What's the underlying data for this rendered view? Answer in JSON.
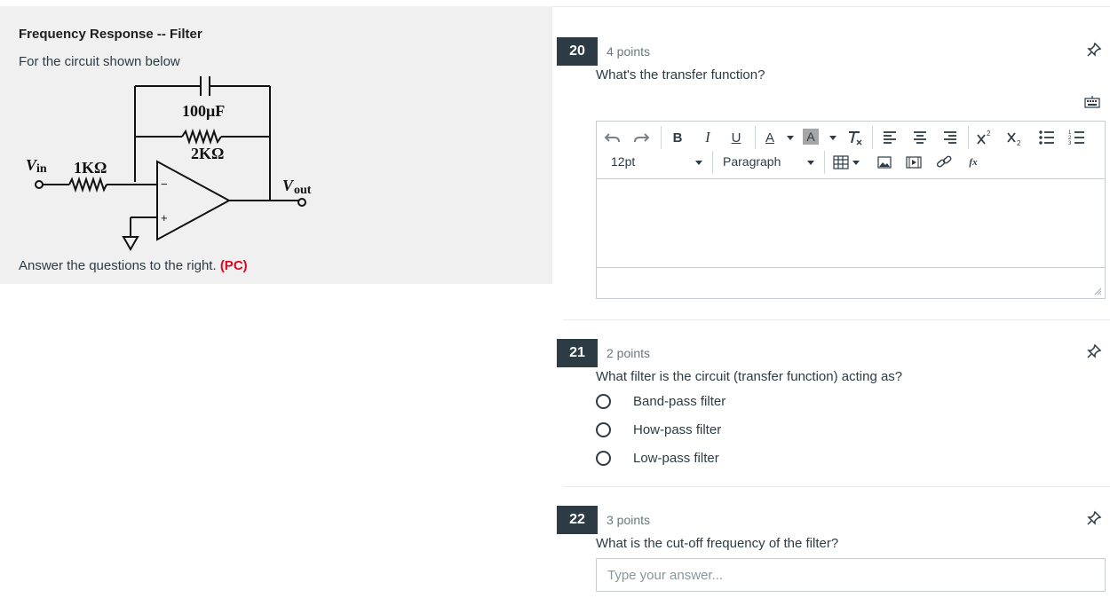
{
  "question_card": {
    "title": "Frequency Response -- Filter",
    "subtitle": "For the circuit shown below",
    "answer_note": "Answer the questions to the right.",
    "answer_note_tag": "(PC)",
    "circuit": {
      "cap_label": "100μF",
      "feedback_res_label": "2KΩ",
      "input_res_label": "1KΩ",
      "vin_label": "V",
      "vin_sub": "in",
      "vout_label": "V",
      "vout_sub": "out",
      "minus": "−",
      "plus": "+"
    }
  },
  "questions": [
    {
      "number": "20",
      "points": "4 points",
      "text": "What's the transfer function?"
    },
    {
      "number": "21",
      "points": "2 points",
      "text": "What filter is the circuit (transfer function) acting as?",
      "options": [
        "Band-pass filter",
        "How-pass filter",
        "Low-pass filter"
      ]
    },
    {
      "number": "22",
      "points": "3 points",
      "text": "What is the cut-off frequency of the filter?",
      "placeholder": "Type your answer..."
    }
  ],
  "editor": {
    "font_size": "12pt",
    "block_format": "Paragraph",
    "buttons": {
      "bold": "B",
      "italic": "I",
      "underline": "U",
      "font_color": "A",
      "bg_color": "A",
      "fx": "fx"
    }
  },
  "colors": {
    "badge_bg": "#2d3b45",
    "accent_red": "#e0061f",
    "panel_bg": "#f0f0f0"
  }
}
